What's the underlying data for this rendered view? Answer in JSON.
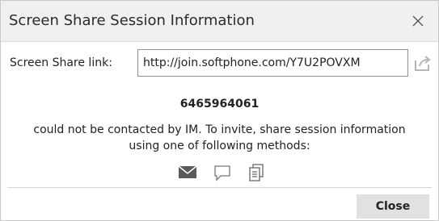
{
  "dialog": {
    "title": "Screen Share Session Information",
    "close_icon": "close-icon"
  },
  "link": {
    "label": "Screen Share link:",
    "value": "http://join.softphone.com/Y7U2POVXM",
    "share_icon": "share-external-icon"
  },
  "contact": {
    "number": "6465964061",
    "message": "could not be contacted by IM. To invite, share session information using one of following methods:"
  },
  "methods": {
    "icons": [
      "email-icon",
      "chat-icon",
      "copy-icon"
    ]
  },
  "footer": {
    "close_label": "Close"
  }
}
